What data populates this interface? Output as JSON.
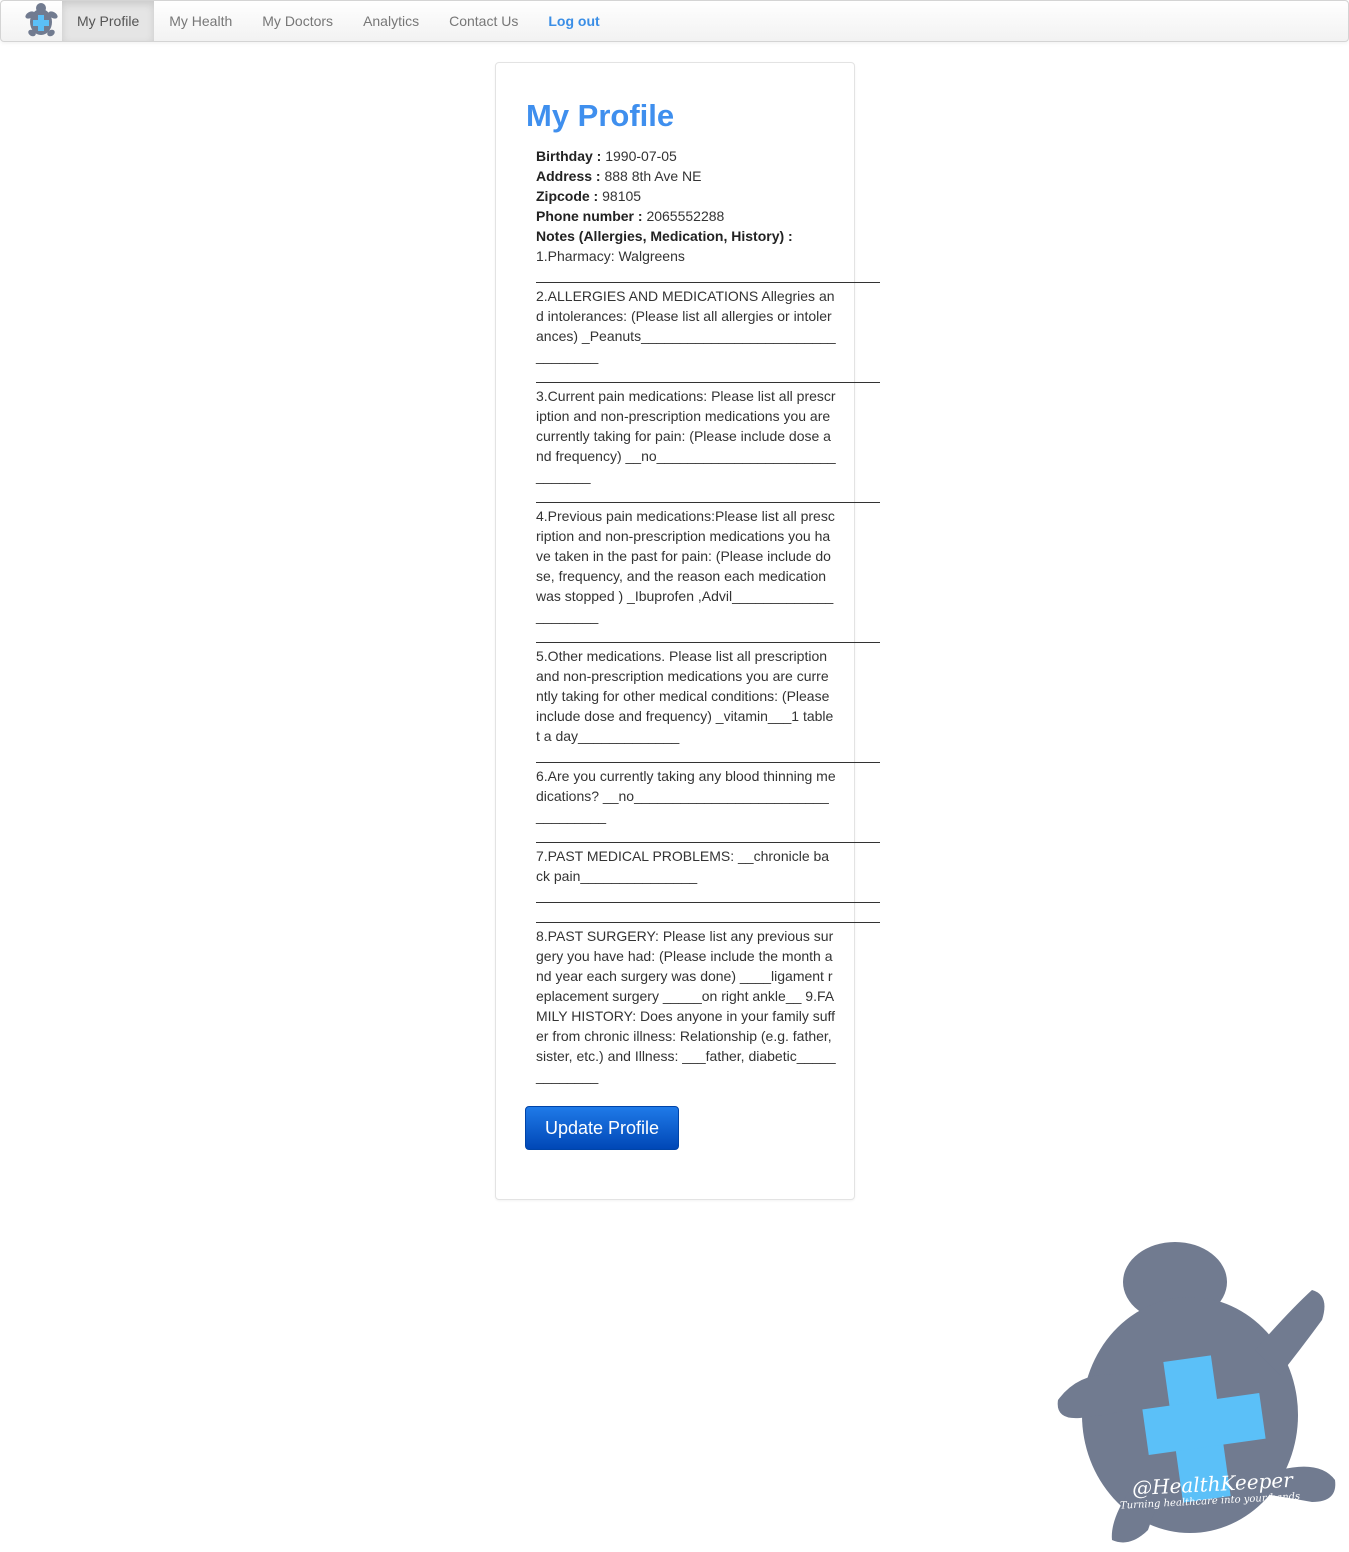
{
  "nav": {
    "logo_icon": "turtle-cross-logo-icon",
    "items": [
      {
        "label": "My Profile",
        "active": true
      },
      {
        "label": "My Health"
      },
      {
        "label": "My Doctors"
      },
      {
        "label": "Analytics"
      },
      {
        "label": "Contact Us"
      },
      {
        "label": "Log out"
      }
    ]
  },
  "profile": {
    "title": "My Profile",
    "birthday_label": "Birthday :",
    "birthday": "1990-07-05",
    "address_label": "Address :",
    "address": "888 8th Ave NE",
    "zipcode_label": "Zipcode :",
    "zipcode": "98105",
    "phone_label": "Phone number :",
    "phone": "2065552288",
    "notes_label": "Notes (Allergies, Medication, History) :",
    "notes": [
      "1.Pharmacy: Walgreens",
      "2.ALLERGIES AND MEDICATIONS Allegries and intolerances: (Please list all allergies or intolerances) _Peanuts_________________________________",
      "3.Current pain medications: Please list all prescription and non-prescription medications you are currently taking for pain: (Please include dose and frequency) __no______________________________",
      "4.Previous pain medications:Please list all prescription and non-prescription medications you have taken in the past for pain: (Please include dose, frequency, and the reason each medication was stopped ) _Ibuprofen ,Advil_____________________",
      "5.Other medications. Please list all prescription and non-prescription medications you are currently taking for other medical conditions: (Please include dose and frequency) _vitamin___1 tablet a day_____________",
      "6.Are you currently taking any blood thinning medications? __no__________________________________",
      "7.PAST MEDICAL PROBLEMS: __chronicle back pain_______________",
      "8.PAST SURGERY: Please list any previous surgery you have had: (Please include the month and year each surgery was done) ____ligament replacement surgery _____on right ankle__ 9.FAMILY HISTORY: Does anyone in your family suffer from chronic illness: Relationship (e.g. father, sister, etc.) and Illness: ___father, diabetic_____________"
    ],
    "update_button": "Update Profile"
  },
  "watermark": {
    "icon": "healthkeeper-turtle-icon",
    "brand": "@HealthKeeper",
    "tagline": "Turning healthcare into your hands",
    "colors": {
      "shell": "#717b90",
      "cross": "#5bc0f8"
    }
  }
}
